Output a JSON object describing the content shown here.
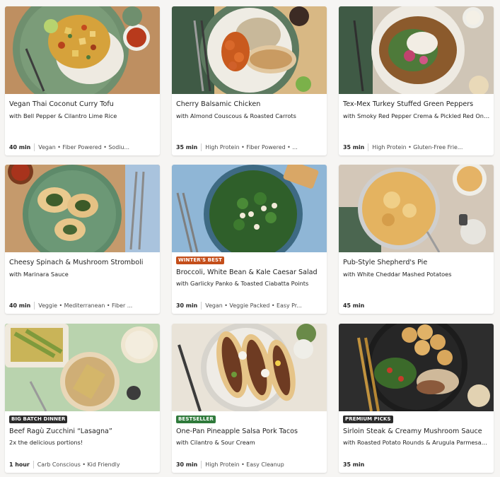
{
  "colors": {
    "winters_best": "#c44e1a",
    "big_batch": "#2b2b2b",
    "bestseller": "#2f7a3b",
    "premium": "#2b2b2b"
  },
  "recipes": [
    {
      "title": "Vegan Thai Coconut Curry Tofu",
      "subtitle": "with Bell Pepper & Cilantro Lime Rice",
      "time": "40 min",
      "tags": "Vegan • Fiber Powered • Sodiu...",
      "badge": ""
    },
    {
      "title": "Cherry Balsamic Chicken",
      "subtitle": "with Almond Couscous & Roasted Carrots",
      "time": "35 min",
      "tags": "High Protein • Fiber Powered • ...",
      "badge": ""
    },
    {
      "title": "Tex-Mex Turkey Stuffed Green Peppers",
      "subtitle": "with Smoky Red Pepper Crema & Pickled Red Onion",
      "time": "35 min",
      "tags": "High Protein • Gluten-Free Frie...",
      "badge": ""
    },
    {
      "title": "Cheesy Spinach & Mushroom Stromboli",
      "subtitle": "with Marinara Sauce",
      "time": "40 min",
      "tags": "Veggie • Mediterranean • Fiber ...",
      "badge": ""
    },
    {
      "title": "Broccoli, White Bean & Kale Caesar Salad",
      "subtitle": "with Garlicky Panko & Toasted Ciabatta Points",
      "time": "30 min",
      "tags": "Vegan • Veggie Packed • Easy Pr...",
      "badge": "WINTER'S BEST"
    },
    {
      "title": "Pub-Style Shepherd's Pie",
      "subtitle": "with White Cheddar Mashed Potatoes",
      "time": "45 min",
      "tags": "",
      "badge": ""
    },
    {
      "title": "Beef Ragù Zucchini “Lasagna”",
      "subtitle": "2x the delicious portions!",
      "time": "1 hour",
      "tags": "Carb Conscious • Kid Friendly",
      "badge": "BIG BATCH DINNER"
    },
    {
      "title": "One-Pan Pineapple Salsa Pork Tacos",
      "subtitle": "with Cilantro & Sour Cream",
      "time": "30 min",
      "tags": "High Protein • Easy Cleanup",
      "badge": "BESTSELLER"
    },
    {
      "title": "Sirloin Steak & Creamy Mushroom Sauce",
      "subtitle": "with Roasted Potato Rounds & Arugula Parmesan Sal...",
      "time": "35 min",
      "tags": "",
      "badge": "PREMIUM PICKS"
    }
  ]
}
